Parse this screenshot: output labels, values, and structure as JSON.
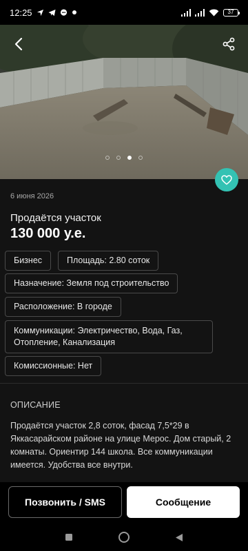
{
  "status": {
    "time": "12:25",
    "battery": "37",
    "left_icons": [
      "navigation-icon",
      "telegram-icon",
      "chat-icon",
      "cloud-icon"
    ],
    "right_icons": [
      "signal-icon",
      "signal-icon",
      "wifi-icon",
      "battery-icon"
    ]
  },
  "gallery": {
    "total_dots": 4,
    "active_index": 2
  },
  "listing": {
    "date": "6 июня 2026",
    "title": "Продаётся участок",
    "price": "130 000 у.е.",
    "tags": {
      "business": "Бизнес",
      "area": "Площадь: 2.80 соток",
      "purpose": "Назначение: Земля под строительство",
      "location": "Расположение: В городе",
      "communications_line1": "Коммуникации: Электричество, Вода, Газ,",
      "communications_line2": "Отопление, Канализация",
      "commission": "Комиссионные: Нет"
    }
  },
  "description": {
    "heading": "ОПИСАНИЕ",
    "text": "Продаётся участок 2,8 соток, фасад 7,5*29 в Яккасарайском районе на улице Мерос. Дом старый, 2 комнаты. Ориентир 144 школа. Все коммуникации имеется. Удобства все внутри."
  },
  "actions": {
    "call_label": "Позвонить / SMS",
    "message_label": "Сообщение"
  },
  "colors": {
    "accent": "#33c2b3",
    "sheet_bg": "#131313"
  }
}
